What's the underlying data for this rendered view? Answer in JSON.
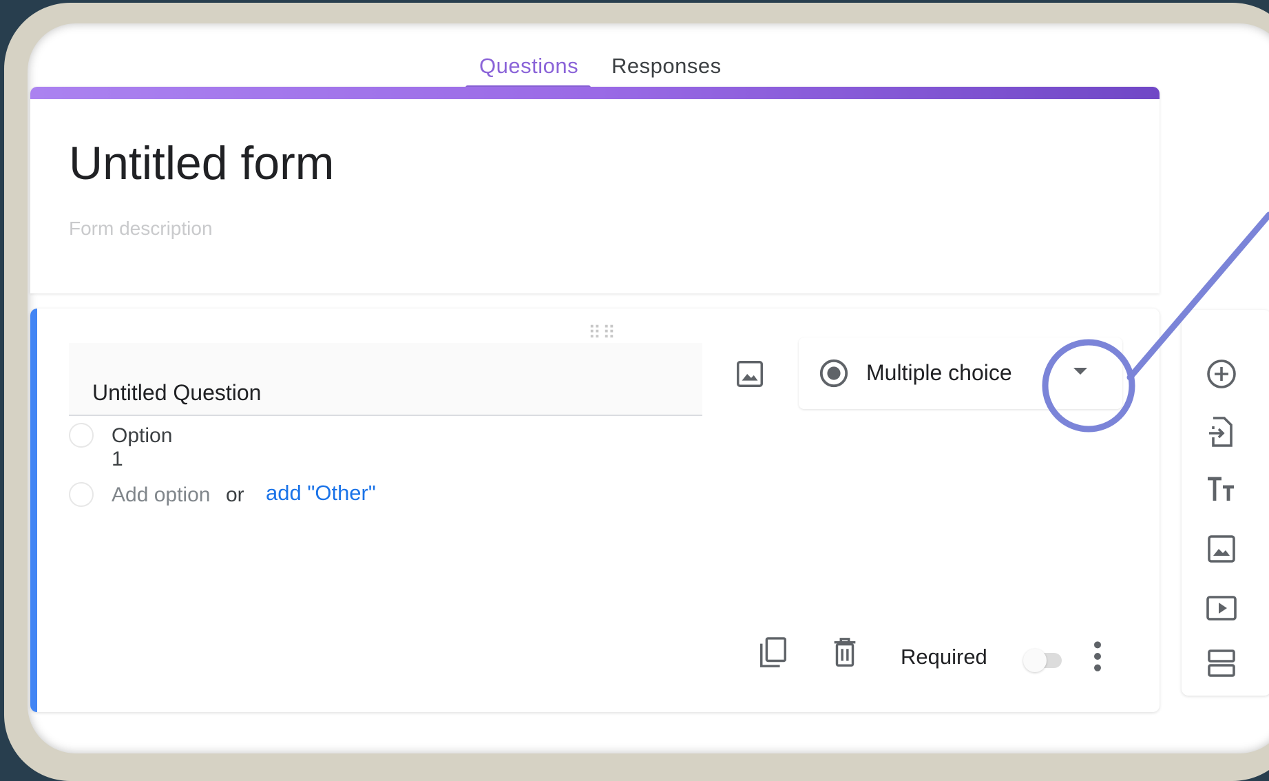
{
  "tabs": {
    "questions": "Questions",
    "responses": "Responses"
  },
  "form": {
    "title": "Untitled form",
    "description_placeholder": "Form description"
  },
  "question": {
    "title": "Untitled Question",
    "type_label": "Multiple choice",
    "options": [
      "Option 1"
    ],
    "add_option": "Add option",
    "or_text": "or",
    "add_other": "add \"Other\"",
    "required_label": "Required",
    "required": false
  },
  "toolbar_icons": [
    "add-question-icon",
    "import-questions-icon",
    "add-title-icon",
    "add-image-icon",
    "add-video-icon",
    "add-section-icon"
  ],
  "colors": {
    "accent": "#8a63d8",
    "question_accent": "#4285f4",
    "link": "#1a73e8",
    "callout": "#7b84d8",
    "background": "#283e4e"
  }
}
